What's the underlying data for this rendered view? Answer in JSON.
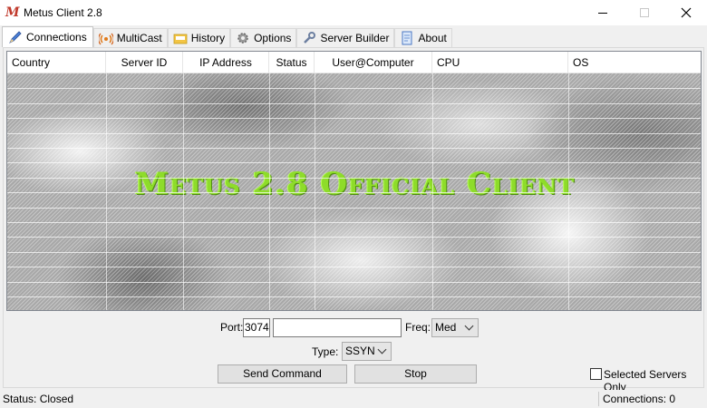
{
  "window": {
    "title": "Metus Client 2.8",
    "icon": "metus-m-icon"
  },
  "tabs": [
    {
      "label": "Connections",
      "icon": "pen-icon",
      "active": true
    },
    {
      "label": "MultiCast",
      "icon": "broadcast-icon",
      "active": false
    },
    {
      "label": "History",
      "icon": "folder-icon",
      "active": false
    },
    {
      "label": "Options",
      "icon": "gear-icon",
      "active": false
    },
    {
      "label": "Server Builder",
      "icon": "wrench-icon",
      "active": false
    },
    {
      "label": "About",
      "icon": "document-icon",
      "active": false
    }
  ],
  "table": {
    "columns": [
      "Country",
      "Server ID",
      "IP Address",
      "Status",
      "User@Computer",
      "CPU",
      "OS"
    ],
    "rows": []
  },
  "watermark": "Metus 2.8 Official Client",
  "controls": {
    "port_label": "Port:",
    "port_value": "3074",
    "target_value": "",
    "freq_label": "Freq:",
    "freq_value": "Med",
    "type_label": "Type:",
    "type_value": "SSYN",
    "send_button": "Send Command",
    "stop_button": "Stop",
    "selected_only_label": "Selected Servers Only",
    "selected_only_checked": false
  },
  "statusbar": {
    "status": "Status: Closed",
    "connections": "Connections: 0"
  },
  "colors": {
    "watermark": "#8edc2a",
    "app_icon": "#c0392b"
  }
}
